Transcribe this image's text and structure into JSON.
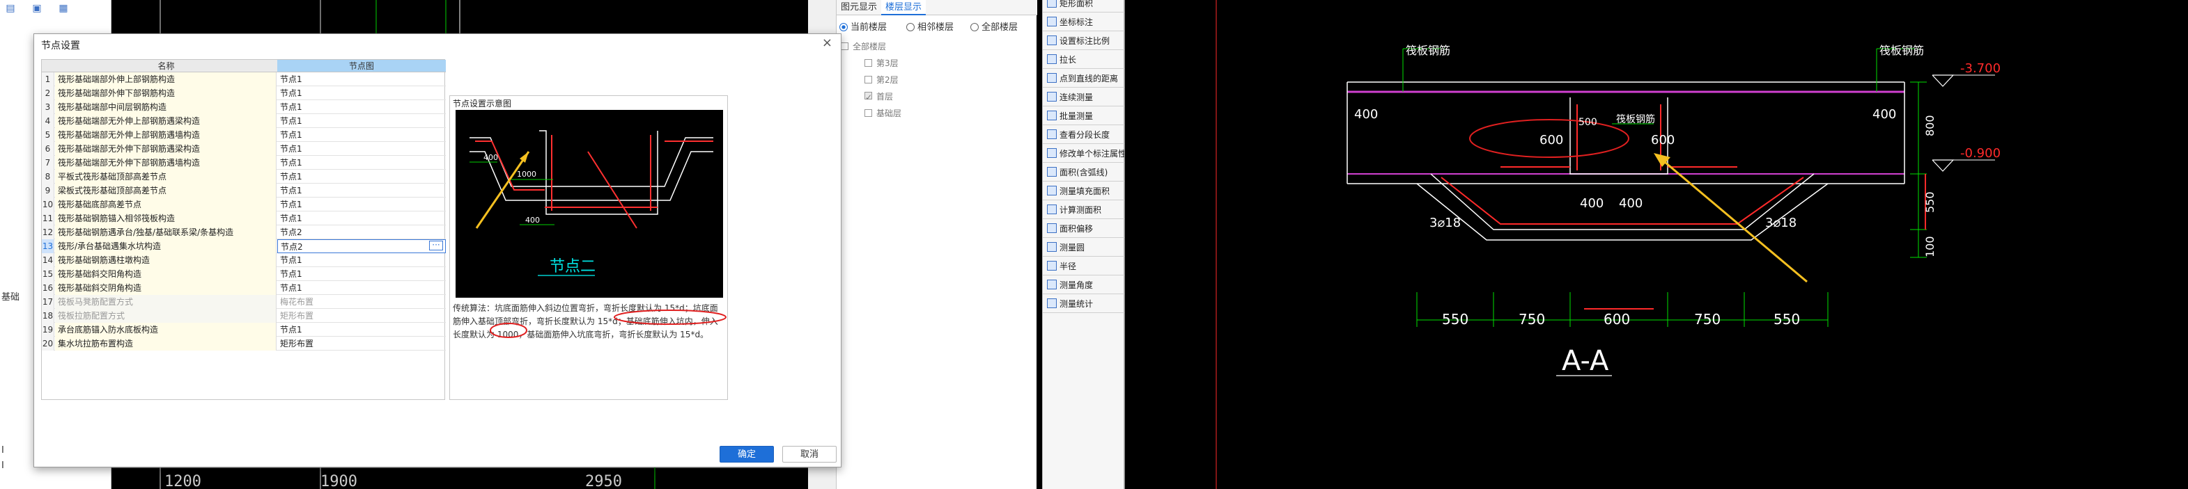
{
  "left_strip": {
    "label_side": "基础",
    "label_i1": "I",
    "label_i2": "I"
  },
  "ruler": {
    "v1": "1200",
    "v2": "1900",
    "v3": "2950"
  },
  "right_panel": {
    "tabs": [
      "图元显示",
      "楼层显示"
    ],
    "radios": [
      "当前楼层",
      "相邻楼层",
      "全部楼层"
    ],
    "tree": [
      "全部楼层",
      "第3层",
      "第2层",
      "首层",
      "基础层"
    ]
  },
  "tools": [
    "矩形面积",
    "坐标标注",
    "设置标注比例",
    "拉长",
    "点到直线的距离",
    "连续测量",
    "批量测量",
    "查看分段长度",
    "修改单个标注属性",
    "面积(含弧线)",
    "测量填充面积",
    "计算测面积",
    "面积偏移",
    "测量圆",
    "半径",
    "测量角度",
    "测量统计"
  ],
  "dialog": {
    "title": "节点设置",
    "close": "×",
    "col_name": "名称",
    "col_value": "节点图",
    "rows": [
      {
        "n": "1",
        "name": "筏形基础端部外伸上部钢筋构造",
        "val": "节点1"
      },
      {
        "n": "2",
        "name": "筏形基础端部外伸下部钢筋构造",
        "val": "节点1"
      },
      {
        "n": "3",
        "name": "筏形基础端部中间层钢筋构造",
        "val": "节点1"
      },
      {
        "n": "4",
        "name": "筏形基础端部无外伸上部钢筋遇梁构造",
        "val": "节点1"
      },
      {
        "n": "5",
        "name": "筏形基础端部无外伸上部钢筋遇墙构造",
        "val": "节点1"
      },
      {
        "n": "6",
        "name": "筏形基础端部无外伸下部钢筋遇梁构造",
        "val": "节点1"
      },
      {
        "n": "7",
        "name": "筏形基础端部无外伸下部钢筋遇墙构造",
        "val": "节点1"
      },
      {
        "n": "8",
        "name": "平板式筏形基础顶部高差节点",
        "val": "节点1"
      },
      {
        "n": "9",
        "name": "梁板式筏形基础顶部高差节点",
        "val": "节点1"
      },
      {
        "n": "10",
        "name": "筏形基础底部高差节点",
        "val": "节点1"
      },
      {
        "n": "11",
        "name": "筏形基础钢筋锚入相邻筏板构造",
        "val": "节点1"
      },
      {
        "n": "12",
        "name": "筏形基础钢筋遇承台/独基/基础联系梁/条基构造",
        "val": "节点2"
      },
      {
        "n": "13",
        "name": "筏形/承台基础遇集水坑构造",
        "val": "节点2"
      },
      {
        "n": "14",
        "name": "筏形基础钢筋遇柱墩构造",
        "val": "节点1"
      },
      {
        "n": "15",
        "name": "筏形基础斜交阳角构造",
        "val": "节点1"
      },
      {
        "n": "16",
        "name": "筏形基础斜交阴角构造",
        "val": "节点1"
      },
      {
        "n": "17",
        "name": "筏板马凳筋配置方式",
        "val": "梅花布置"
      },
      {
        "n": "18",
        "name": "筏板拉筋配置方式",
        "val": "矩形布置"
      },
      {
        "n": "19",
        "name": "承台底筋锚入防水底板构造",
        "val": "节点1"
      },
      {
        "n": "20",
        "name": "集水坑拉筋布置构造",
        "val": "矩形布置"
      }
    ],
    "selected_index": 12,
    "ellipsis": "···",
    "preview_title": "节点设置示意图",
    "preview_node_label": "节点二",
    "preview_dims": [
      "400",
      "1000",
      "400"
    ],
    "preview_text": "传统算法：坑底面筋伸入斜边位置弯折，弯折长度默认为 15*d；坑底面筋伸入基础顶部弯折，弯折长度默认为 15*d；基础底筋伸入坑内，伸入长度默认为 1000，基础面筋伸入坑底弯折，弯折长度默认为 15*d。",
    "ok": "确定",
    "cancel": "取消"
  },
  "cad": {
    "label_left": "筏板钢筋",
    "label_right": "筏板钢筋",
    "label_center": "筏板钢筋",
    "elev1": "-3.700",
    "elev2": "-0.900",
    "d400a": "400",
    "d400b": "400",
    "d600a": "600",
    "d500": "500",
    "d600b": "600",
    "d400c": "400",
    "d400d": "400",
    "rebar_l": "3⌀18",
    "rebar_r": "3⌀18",
    "v800": "800",
    "v550": "550",
    "v100": "100",
    "dims_bottom": [
      "550",
      "750",
      "600",
      "750",
      "550"
    ],
    "section": "A-A"
  },
  "colors": {
    "accent": "#1e6fd8",
    "cad_green": "#00e000",
    "cad_red": "#ff2a2a",
    "cad_yellow": "#f5c020",
    "cad_magenta": "#d040d0"
  }
}
